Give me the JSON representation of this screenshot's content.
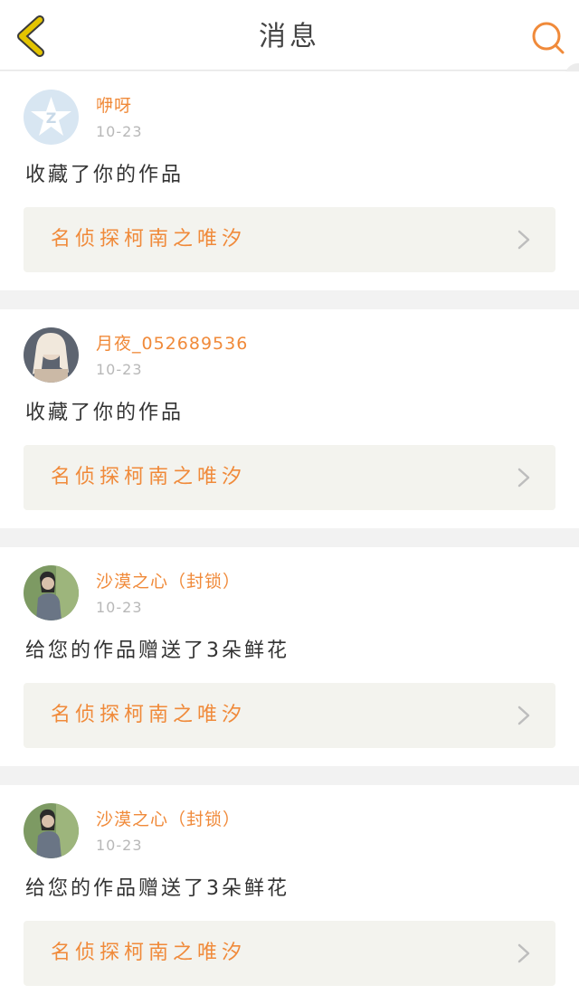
{
  "header": {
    "title": "消息"
  },
  "notifications": [
    {
      "username": "咿呀",
      "time": "10-23",
      "message": "收藏了你的作品",
      "work_title": "名侦探柯南之唯汐",
      "avatar": "qq-default-avatar"
    },
    {
      "username": "月夜_052689536",
      "time": "10-23",
      "message": "收藏了你的作品",
      "work_title": "名侦探柯南之唯汐",
      "avatar": "user-photo-avatar"
    },
    {
      "username": "沙漠之心（封锁）",
      "time": "10-23",
      "message": "给您的作品赠送了3朵鲜花",
      "work_title": "名侦探柯南之唯汐",
      "avatar": "user-photo-avatar"
    },
    {
      "username": "沙漠之心（封锁）",
      "time": "10-23",
      "message": "给您的作品赠送了3朵鲜花",
      "work_title": "名侦探柯南之唯汐",
      "avatar": "user-photo-avatar"
    }
  ],
  "colors": {
    "accent": "#f08a3a",
    "back_icon": "#e3c400",
    "card_bg": "#f3f3ee"
  }
}
